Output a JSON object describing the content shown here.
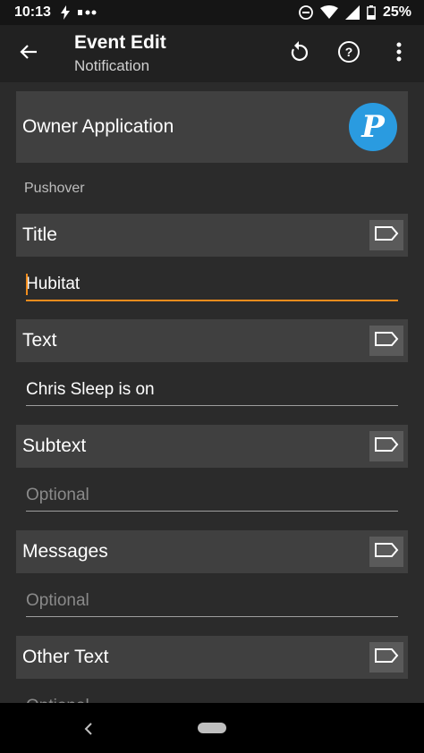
{
  "status_bar": {
    "time": "10:13",
    "battery": "25%",
    "left_icons": [
      "flash-icon",
      "more-dots-icon"
    ],
    "right_icons": [
      "dnd-icon",
      "wifi-icon",
      "signal-icon",
      "battery-icon"
    ]
  },
  "app_bar": {
    "title": "Event Edit",
    "subtitle": "Notification",
    "actions": [
      "undo-icon",
      "help-icon",
      "overflow-menu-icon"
    ]
  },
  "owner_application": {
    "label": "Owner Application",
    "app_icon_letter": "P",
    "app_icon_color": "#2a9be0"
  },
  "section": {
    "label": "Pushover"
  },
  "fields": [
    {
      "label": "Title",
      "value": "Hubitat",
      "placeholder": "",
      "focused": true
    },
    {
      "label": "Text",
      "value": "Chris Sleep is on",
      "placeholder": ""
    },
    {
      "label": "Subtext",
      "value": "",
      "placeholder": "Optional"
    },
    {
      "label": "Messages",
      "value": "",
      "placeholder": "Optional"
    },
    {
      "label": "Other Text",
      "value": "",
      "placeholder": "Optional"
    }
  ],
  "colors": {
    "accent": "#f08c1d",
    "row_bg": "#404040",
    "background": "#2b2b2b",
    "app_bar": "#212121"
  }
}
